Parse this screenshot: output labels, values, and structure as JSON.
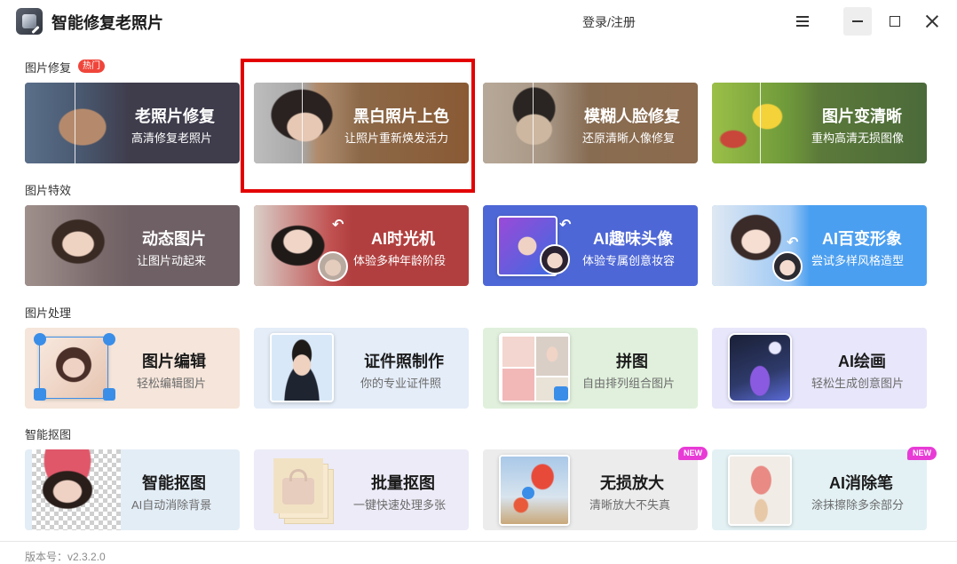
{
  "app": {
    "title": "智能修复老照片",
    "login": "登录/注册",
    "version": "版本号：v2.3.2.0"
  },
  "sections": {
    "repair": {
      "label": "图片修复",
      "badge": "热门"
    },
    "effects": {
      "label": "图片特效"
    },
    "processing": {
      "label": "图片处理"
    },
    "cutout": {
      "label": "智能抠图"
    }
  },
  "cards": {
    "old_photo": {
      "title": "老照片修复",
      "sub": "高清修复老照片"
    },
    "colorize": {
      "title": "黑白照片上色",
      "sub": "让照片重新焕发活力"
    },
    "face": {
      "title": "模糊人脸修复",
      "sub": "还原清晰人像修复"
    },
    "sharpen": {
      "title": "图片变清晰",
      "sub": "重构高清无损图像"
    },
    "animate": {
      "title": "动态图片",
      "sub": "让图片动起来"
    },
    "time": {
      "title": "AI时光机",
      "sub": "体验多种年龄阶段"
    },
    "avatar": {
      "title": "AI趣味头像",
      "sub": "体验专属创意妆容"
    },
    "style": {
      "title": "AI百变形象",
      "sub": "尝试多样风格造型"
    },
    "edit": {
      "title": "图片编辑",
      "sub": "轻松编辑图片"
    },
    "id_photo": {
      "title": "证件照制作",
      "sub": "你的专业证件照"
    },
    "collage": {
      "title": "拼图",
      "sub": "自由排列组合图片"
    },
    "paint": {
      "title": "AI绘画",
      "sub": "轻松生成创意图片"
    },
    "smart_cut": {
      "title": "智能抠图",
      "sub": "AI自动消除背景"
    },
    "batch_cut": {
      "title": "批量抠图",
      "sub": "一键快速处理多张"
    },
    "upscale": {
      "title": "无损放大",
      "sub": "清晰放大不失真",
      "badge": "NEW"
    },
    "erase": {
      "title": "AI消除笔",
      "sub": "涂抹擦除多余部分",
      "badge": "NEW"
    }
  },
  "icons": {
    "menu": "hamburger-icon",
    "minimize": "minimize-icon",
    "maximize": "maximize-icon",
    "close": "close-icon"
  },
  "colors": {
    "highlight": "#e30000",
    "hot": "#f0453a",
    "new": "#e83bd6"
  }
}
